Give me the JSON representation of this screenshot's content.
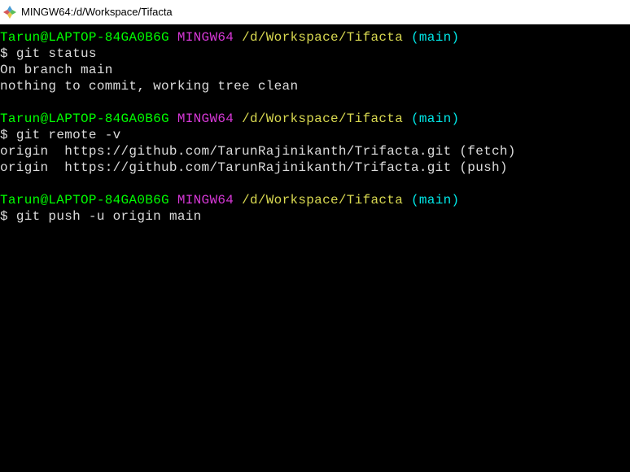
{
  "titleBar": {
    "title": "MINGW64:/d/Workspace/Tifacta"
  },
  "prompt": {
    "user": "Tarun@LAPTOP-84GA0B6G",
    "env": "MINGW64",
    "path": "/d/Workspace/Tifacta",
    "branchOpen": "(",
    "branch": "main",
    "branchClose": ")",
    "symbol": "$ "
  },
  "block1": {
    "cmd": "git status",
    "out1": "On branch main",
    "out2": "nothing to commit, working tree clean"
  },
  "block2": {
    "cmd": "git remote -v",
    "out1": "origin  https://github.com/TarunRajinikanth/Trifacta.git (fetch)",
    "out2": "origin  https://github.com/TarunRajinikanth/Trifacta.git (push)"
  },
  "block3": {
    "cmd": "git push -u origin main"
  }
}
